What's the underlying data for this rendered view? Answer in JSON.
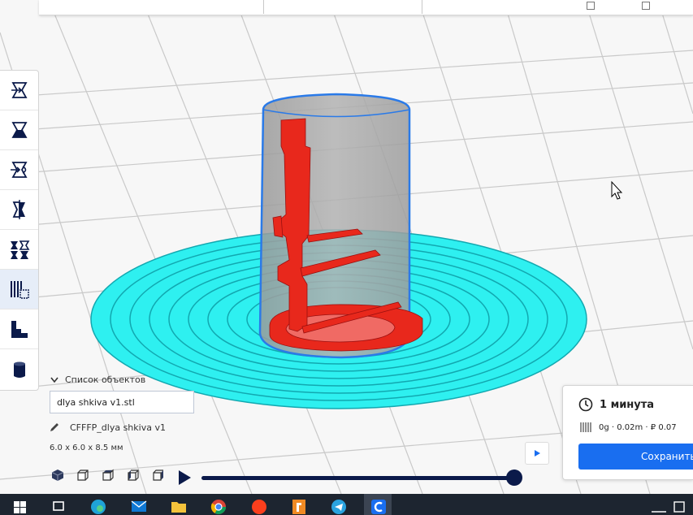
{
  "object_list": {
    "title": "Список объектов",
    "object_name": "dlya shkiva v1.stl",
    "profile_name": "CFFFP_dlya shkiva v1",
    "dimensions": "6.0 x 6.0 x 8.5 мм"
  },
  "print_panel": {
    "time": "1 минута",
    "material": "0g · 0.02m · ₽ 0.07",
    "save_label": "Сохранить"
  },
  "preview": {
    "layer_progress": 1.0
  },
  "toolbar": {
    "tools": [
      {
        "name": "move-tool-icon"
      },
      {
        "name": "scale-tool-icon"
      },
      {
        "name": "rotate-tool-icon"
      },
      {
        "name": "mirror-tool-icon"
      },
      {
        "name": "per-model-settings-icon"
      },
      {
        "name": "support-blocker-icon",
        "active": true
      },
      {
        "name": "layer-view-icon"
      },
      {
        "name": "cylinder-mesh-icon"
      }
    ]
  },
  "taskbar": {
    "apps": [
      "start-icon",
      "task-view-icon",
      "edge-icon",
      "mail-icon",
      "explorer-icon",
      "chrome-icon",
      "yandex-icon",
      "fusion-icon",
      "telegram-icon",
      "cura-icon"
    ],
    "active_app": "cura-icon"
  },
  "colors": {
    "accent": "#196ef0",
    "brim": "#2ef0f0",
    "model": "#e8281c",
    "dark_navy": "#0b1a4a"
  }
}
